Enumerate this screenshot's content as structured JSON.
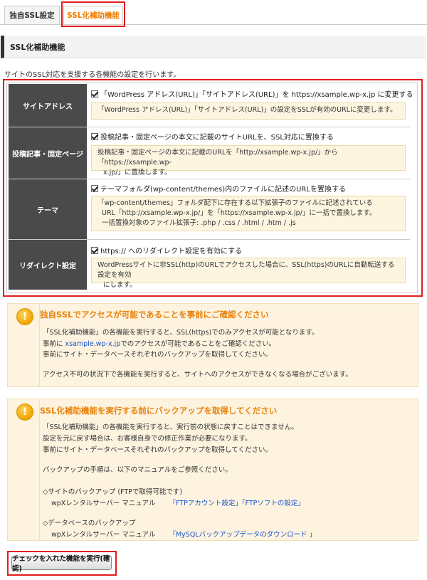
{
  "tabs": [
    {
      "label": "独自SSL設定"
    },
    {
      "label": "SSL化補助機能"
    }
  ],
  "section_title": "SSL化補助機能",
  "description": "サイトのSSL対応を支援する各機能の設定を行います。",
  "rows": [
    {
      "label": "サイトアドレス",
      "checkbox_label": "「WordPress アドレス(URL)」「サイトアドレス(URL)」を https://xsample.wp-x.jp に変更する",
      "checked": true,
      "note": [
        "「WordPress アドレス(URL)」「サイトアドレス(URL)」の設定をSSLが有効のURLに変更します。"
      ]
    },
    {
      "label": "投稿記事・固定ページ",
      "checkbox_label": "投稿記事・固定ページの本文に記載のサイトURLを、SSL対応に置換する",
      "checked": true,
      "note": [
        "投稿記事・固定ページの本文に記載のURLを「http://xsample.wp-x.jp/」から「https://xsample.wp-",
        "x.jp/」に置換します。"
      ]
    },
    {
      "label": "テーマ",
      "checkbox_label": "テーマフォルダ(wp-content/themes)内のファイルに記述のURLを置換する",
      "checked": true,
      "note": [
        "「wp-content/themes」フォルダ配下に存在する以下拡張子のファイルに記述されている",
        "URL「http://xsample.wp-x.jp/」を「https://xsample.wp-x.jp/」に一括で置換します。",
        "一括置換対象のファイル拡張子: .php / .css / .html / .htm / .js"
      ]
    },
    {
      "label": "リダイレクト設定",
      "checkbox_label": "https:// へのリダイレクト設定を有効にする",
      "checked": true,
      "note": [
        "WordPressサイトに非SSL(http)のURLでアクセスした場合に、SSL(https)のURLに自動転送する設定を有効",
        "にします。"
      ]
    }
  ],
  "info1": {
    "icon": "exclamation-icon",
    "title": "独自SSLでアクセスが可能であることを事前にご確認ください",
    "line1": "「SSL化補助機能」の各機能を実行すると、SSL(https)でのみアクセスが可能となります。",
    "line2_pre": "事前に ",
    "line2_link": "xsample.wp-x.jp",
    "line2_post": "でのアクセスが可能であることをご確認ください。",
    "line3": "事前にサイト・データベースそれぞれのバックアップを取得してください。",
    "line4": "アクセス不可の状況下で各機能を実行すると、サイトへのアクセスができなくなる場合がございます。"
  },
  "info2": {
    "icon": "exclamation-icon",
    "title": "SSL化補助機能を実行する前にバックアップを取得してください",
    "line1": "「SSL化補助機能」の各機能を実行すると、実行前の状態に戻すことはできません。",
    "line2": "設定を元に戻す場合は、お客様自身での修正作業が必要になります。",
    "line3": "事前にサイト・データベースそれぞれのバックアップを取得してください。",
    "line4": "バックアップの手順は、以下のマニュアルをご参照ください。",
    "site_backup": "◇サイトのバックアップ (FTPで取得可能です)",
    "site_manual_prefix": "wpXレンタルサーバー マニュアル",
    "site_link1": "「FTPアカウント設定」",
    "site_link2": "「FTPソフトの設定」",
    "db_backup": "◇データベースのバックアップ",
    "db_manual_prefix": "wpXレンタルサーバー マニュアル",
    "db_link": "「MySQLバックアップデータのダウンロード 」"
  },
  "execute_button": "チェックを入れた機能を実行(確認)",
  "highlight_color": "#e21c1c",
  "accent_color": "#ee7b00"
}
